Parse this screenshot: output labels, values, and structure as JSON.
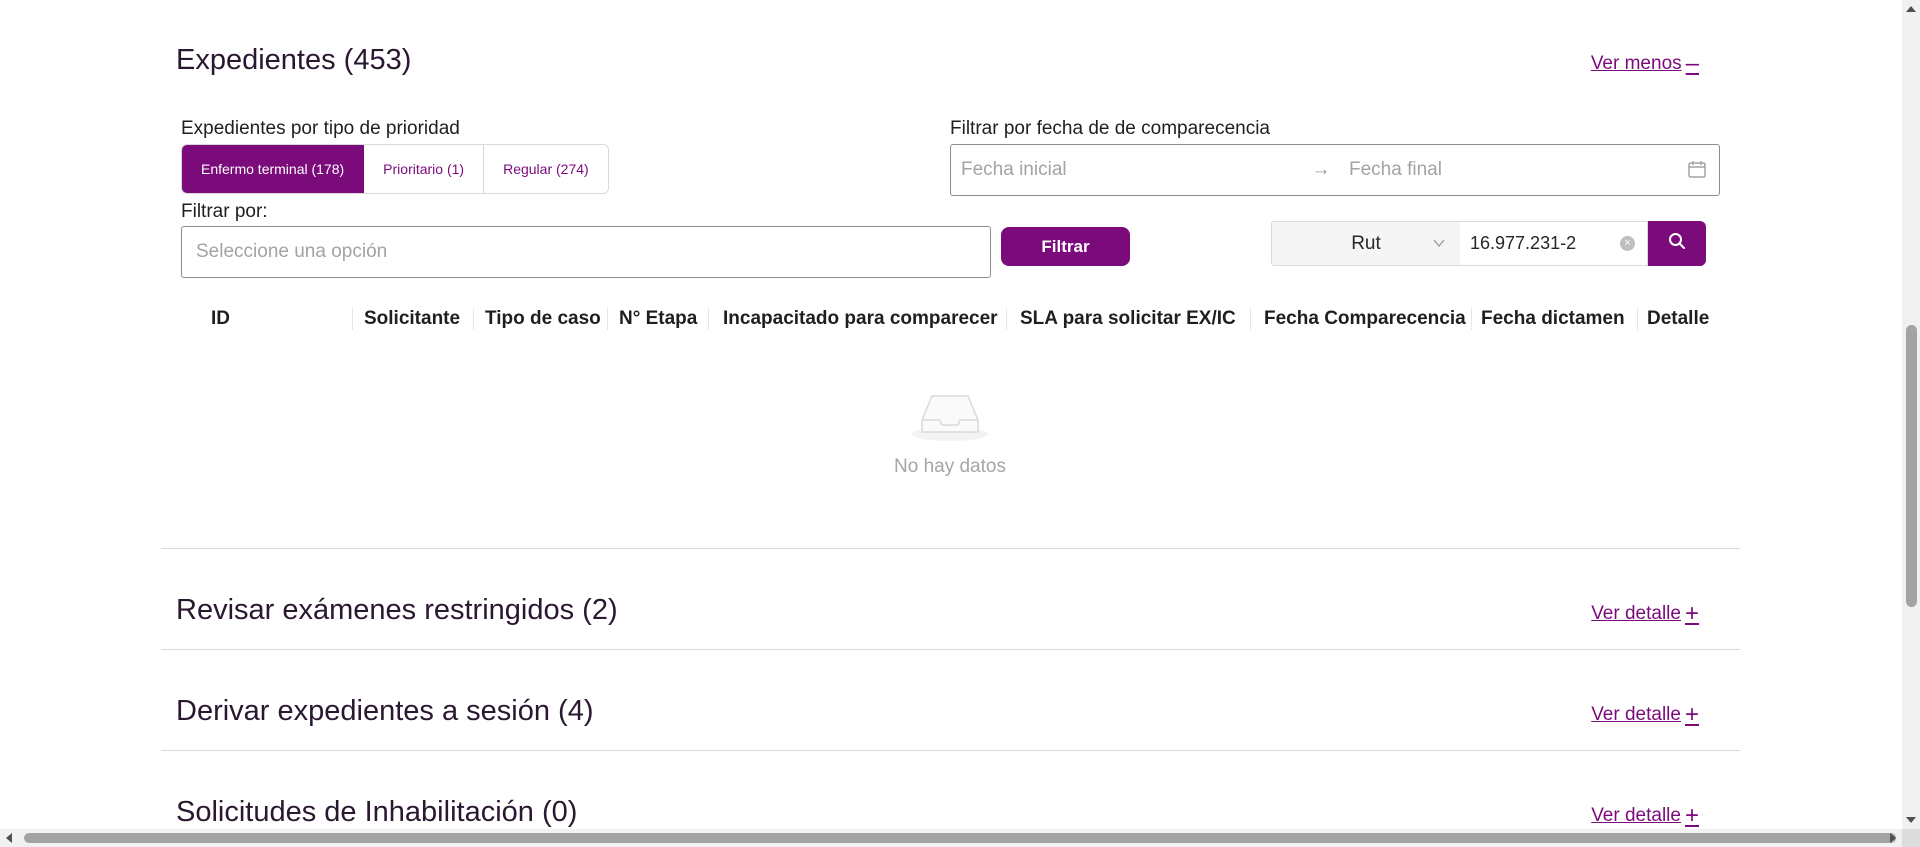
{
  "expedientes": {
    "title": "Expedientes (453)",
    "toggle_label": "Ver menos",
    "toggle_icon": "minus-icon",
    "priority_label": "Expedientes por tipo de prioridad",
    "priority_buttons": [
      {
        "label": "Enfermo terminal (178)",
        "active": true
      },
      {
        "label": "Prioritario (1)",
        "active": false
      },
      {
        "label": "Regular (274)",
        "active": false
      }
    ],
    "date_filter_label": "Filtrar por fecha de de comparecencia",
    "date_start_placeholder": "Fecha inicial",
    "date_end_placeholder": "Fecha final",
    "filter_label": "Filtrar por:",
    "filter_placeholder": "Seleccione una opción",
    "filter_button": "Filtrar",
    "search_type": "Rut",
    "search_value": "16.977.231-2",
    "table_columns": [
      "ID",
      "Solicitante",
      "Tipo de caso",
      "N° Etapa",
      "Incapacitado para comparecer",
      "SLA para solicitar EX/IC",
      "Fecha Comparecencia",
      "Fecha dictamen",
      "Detalle"
    ],
    "empty_text": "No hay datos"
  },
  "sections": [
    {
      "title": "Revisar exámenes restringidos (2)",
      "link": "Ver detalle"
    },
    {
      "title": "Derivar expedientes a sesión (4)",
      "link": "Ver detalle"
    },
    {
      "title": "Solicitudes de Inhabilitación (0)",
      "link": "Ver detalle"
    }
  ],
  "colors": {
    "accent": "#7b0a7b",
    "text": "#1f1f1f",
    "muted": "#a3a3a3"
  }
}
